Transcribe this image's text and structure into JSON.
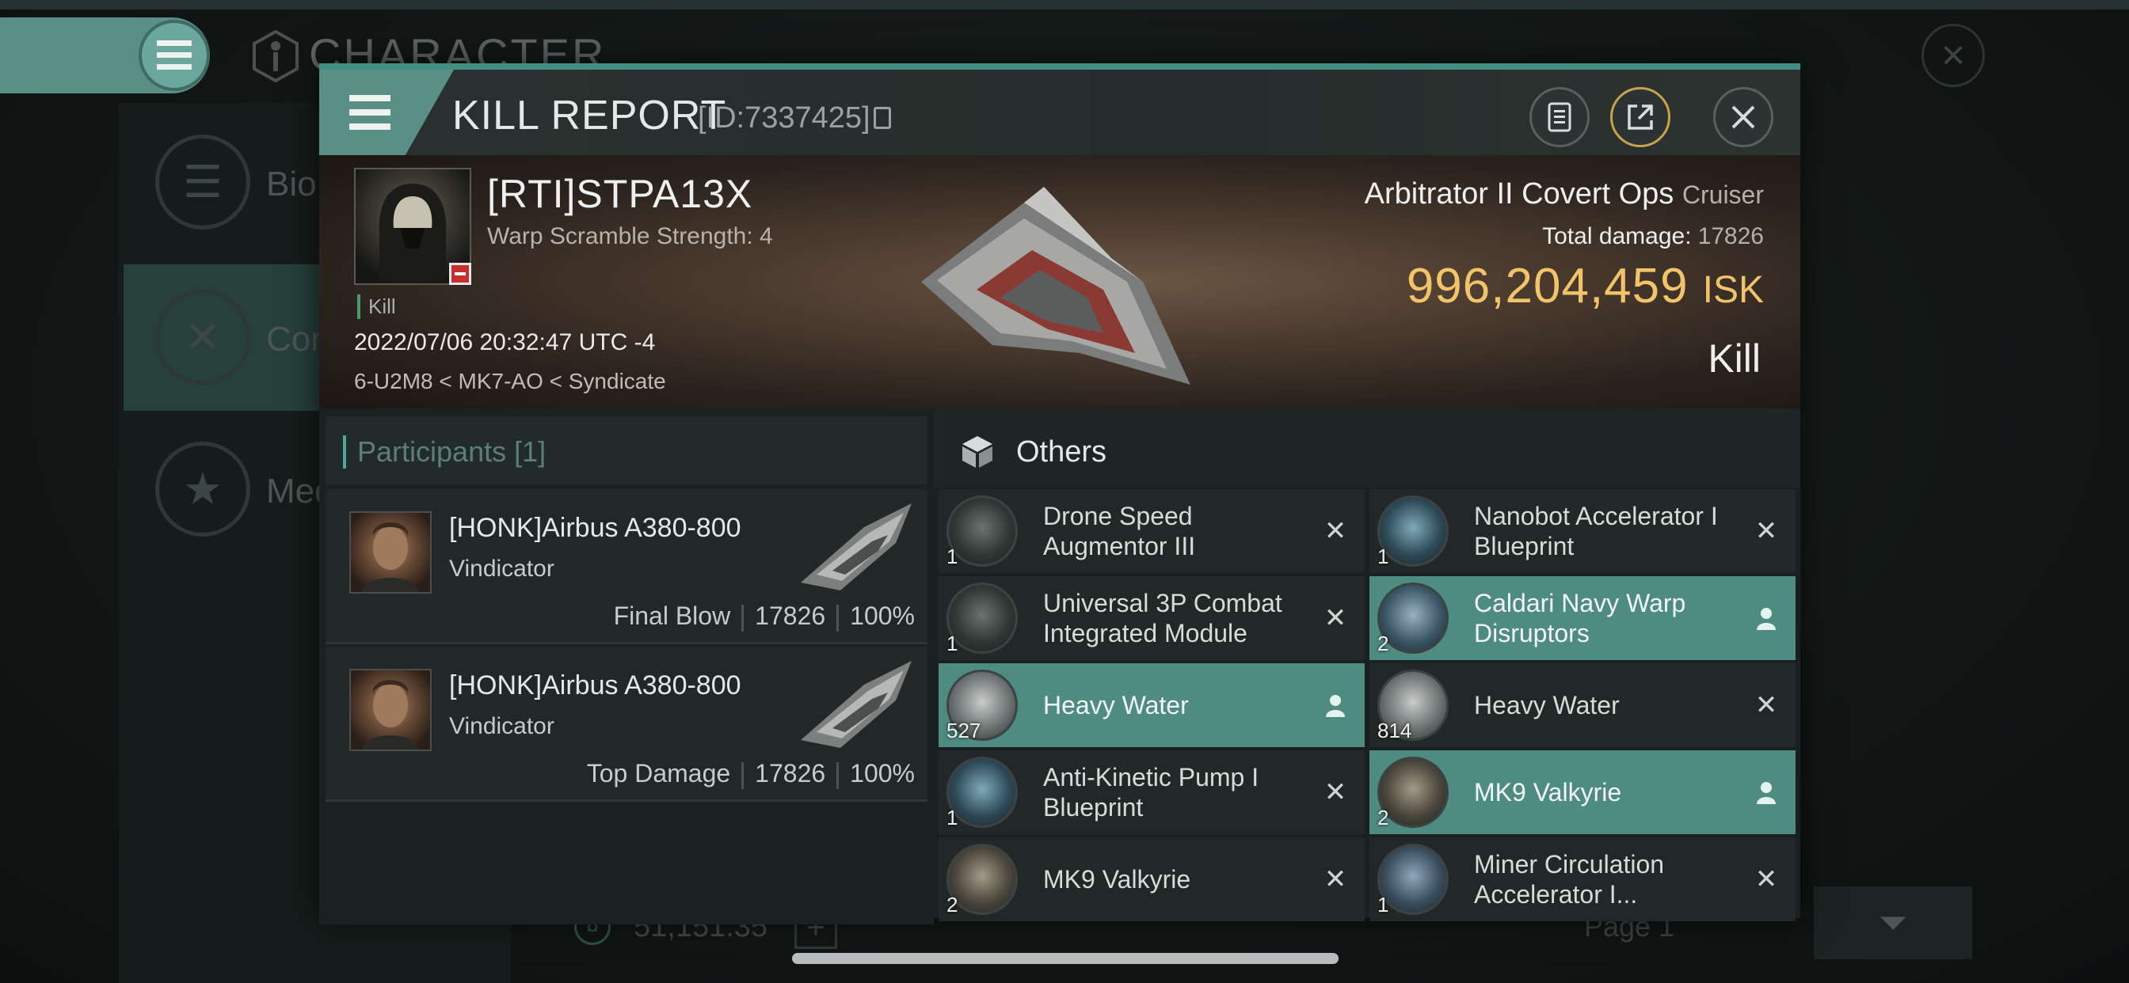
{
  "background": {
    "title": "CHARACTER",
    "side_items": [
      "Bio",
      "Com",
      "Med"
    ],
    "isk_value": "51,151.35",
    "page_label": "Page 1"
  },
  "modal": {
    "title": "KILL REPORT",
    "id_text": "[ID:7337425]",
    "victim": {
      "name": "[RTI]STPA13X",
      "warp_scramble": "Warp Scramble Strength: 4",
      "tag": "Kill",
      "datetime": "2022/07/06 20:32:47 UTC -4",
      "location": "6-U2M8 < MK7-AO < Syndicate"
    },
    "ship": {
      "name": "Arbitrator II Covert Ops",
      "class": "Cruiser",
      "total_damage_label": "Total damage:",
      "total_damage": "17826",
      "isk_value": "996,204,459",
      "isk_unit": "ISK",
      "kill_type": "Kill"
    },
    "participants": {
      "title": "Participants",
      "count": "[1]",
      "rows": [
        {
          "name": "[HONK]Airbus A380-800",
          "ship": "Vindicator",
          "role": "Final Blow",
          "damage": "17826",
          "percent": "100%"
        },
        {
          "name": "[HONK]Airbus A380-800",
          "ship": "Vindicator",
          "role": "Top Damage",
          "damage": "17826",
          "percent": "100%"
        }
      ]
    },
    "others": {
      "title": "Others",
      "items": [
        {
          "label": "Drone Speed Augmentor III",
          "qty": "1",
          "status": "destroyed"
        },
        {
          "label": "Nanobot Accelerator I Blueprint",
          "qty": "1",
          "status": "destroyed"
        },
        {
          "label": "Universal 3P Combat Integrated Module",
          "qty": "1",
          "status": "destroyed"
        },
        {
          "label": "Caldari Navy Warp Disruptors",
          "qty": "2",
          "status": "dropped"
        },
        {
          "label": "Heavy Water",
          "qty": "527",
          "status": "dropped"
        },
        {
          "label": "Heavy Water",
          "qty": "814",
          "status": "destroyed"
        },
        {
          "label": "Anti-Kinetic Pump I Blueprint",
          "qty": "1",
          "status": "destroyed"
        },
        {
          "label": "MK9  Valkyrie",
          "qty": "2",
          "status": "dropped"
        },
        {
          "label": "MK9  Valkyrie",
          "qty": "2",
          "status": "destroyed"
        },
        {
          "label": "Miner Circulation Accelerator I...",
          "qty": "1",
          "status": "destroyed"
        }
      ]
    }
  },
  "colors": {
    "accent": "#5a8f86",
    "isk": "#f1c46a",
    "highlight_row": "#4e8c82"
  }
}
